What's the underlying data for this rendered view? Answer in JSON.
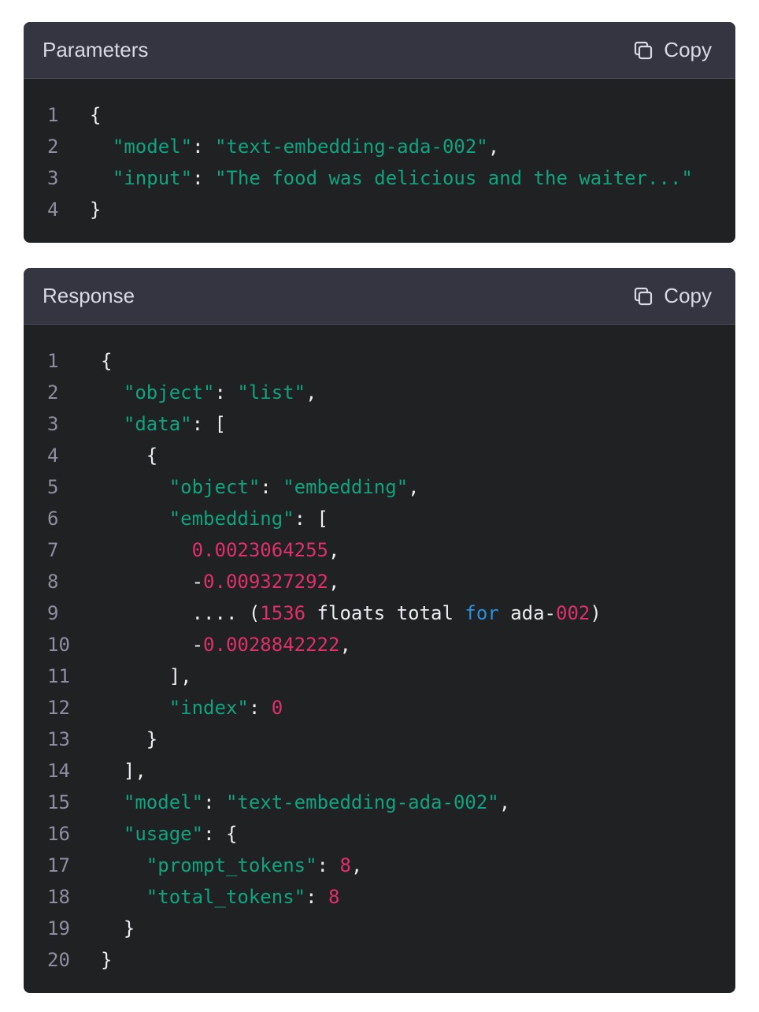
{
  "colors": {
    "panel_bg": "#202123",
    "header_bg": "#343541",
    "string": "#10a37f",
    "number": "#e0306a",
    "keyword": "#2b8fdb",
    "line_number": "#8e8ea0"
  },
  "parameters": {
    "title": "Parameters",
    "copy_label": "Copy",
    "copy_icon": "copy-icon",
    "lines": [
      {
        "n": "1",
        "tokens": [
          {
            "t": "{",
            "c": "punc"
          }
        ]
      },
      {
        "n": "2",
        "tokens": [
          {
            "t": "  ",
            "c": "plain"
          },
          {
            "t": "\"model\"",
            "c": "key"
          },
          {
            "t": ": ",
            "c": "punc"
          },
          {
            "t": "\"text-embedding-ada-002\"",
            "c": "str"
          },
          {
            "t": ",",
            "c": "punc"
          }
        ]
      },
      {
        "n": "3",
        "tokens": [
          {
            "t": "  ",
            "c": "plain"
          },
          {
            "t": "\"input\"",
            "c": "key"
          },
          {
            "t": ": ",
            "c": "punc"
          },
          {
            "t": "\"The food was delicious and the waiter...\"",
            "c": "str"
          }
        ]
      },
      {
        "n": "4",
        "tokens": [
          {
            "t": "}",
            "c": "punc"
          }
        ]
      }
    ]
  },
  "response": {
    "title": "Response",
    "copy_label": "Copy",
    "copy_icon": "copy-icon",
    "lines": [
      {
        "n": "1",
        "tokens": [
          {
            "t": "{",
            "c": "punc"
          }
        ]
      },
      {
        "n": "2",
        "tokens": [
          {
            "t": "  ",
            "c": "plain"
          },
          {
            "t": "\"object\"",
            "c": "key"
          },
          {
            "t": ": ",
            "c": "punc"
          },
          {
            "t": "\"list\"",
            "c": "str"
          },
          {
            "t": ",",
            "c": "punc"
          }
        ]
      },
      {
        "n": "3",
        "tokens": [
          {
            "t": "  ",
            "c": "plain"
          },
          {
            "t": "\"data\"",
            "c": "key"
          },
          {
            "t": ": [",
            "c": "punc"
          }
        ]
      },
      {
        "n": "4",
        "tokens": [
          {
            "t": "    {",
            "c": "punc"
          }
        ]
      },
      {
        "n": "5",
        "tokens": [
          {
            "t": "      ",
            "c": "plain"
          },
          {
            "t": "\"object\"",
            "c": "key"
          },
          {
            "t": ": ",
            "c": "punc"
          },
          {
            "t": "\"embedding\"",
            "c": "str"
          },
          {
            "t": ",",
            "c": "punc"
          }
        ]
      },
      {
        "n": "6",
        "tokens": [
          {
            "t": "      ",
            "c": "plain"
          },
          {
            "t": "\"embedding\"",
            "c": "key"
          },
          {
            "t": ": [",
            "c": "punc"
          }
        ]
      },
      {
        "n": "7",
        "tokens": [
          {
            "t": "        ",
            "c": "plain"
          },
          {
            "t": "0.0023064255",
            "c": "num"
          },
          {
            "t": ",",
            "c": "punc"
          }
        ]
      },
      {
        "n": "8",
        "tokens": [
          {
            "t": "        -",
            "c": "plain"
          },
          {
            "t": "0.009327292",
            "c": "num"
          },
          {
            "t": ",",
            "c": "punc"
          }
        ]
      },
      {
        "n": "9",
        "tokens": [
          {
            "t": "        .... (",
            "c": "plain"
          },
          {
            "t": "1536",
            "c": "num"
          },
          {
            "t": " floats total ",
            "c": "plain"
          },
          {
            "t": "for",
            "c": "kw"
          },
          {
            "t": " ada-",
            "c": "plain"
          },
          {
            "t": "002",
            "c": "num"
          },
          {
            "t": ")",
            "c": "plain"
          }
        ]
      },
      {
        "n": "10",
        "tokens": [
          {
            "t": "        -",
            "c": "plain"
          },
          {
            "t": "0.0028842222",
            "c": "num"
          },
          {
            "t": ",",
            "c": "punc"
          }
        ]
      },
      {
        "n": "11",
        "tokens": [
          {
            "t": "      ],",
            "c": "punc"
          }
        ]
      },
      {
        "n": "12",
        "tokens": [
          {
            "t": "      ",
            "c": "plain"
          },
          {
            "t": "\"index\"",
            "c": "key"
          },
          {
            "t": ": ",
            "c": "punc"
          },
          {
            "t": "0",
            "c": "num"
          }
        ]
      },
      {
        "n": "13",
        "tokens": [
          {
            "t": "    }",
            "c": "punc"
          }
        ]
      },
      {
        "n": "14",
        "tokens": [
          {
            "t": "  ],",
            "c": "punc"
          }
        ]
      },
      {
        "n": "15",
        "tokens": [
          {
            "t": "  ",
            "c": "plain"
          },
          {
            "t": "\"model\"",
            "c": "key"
          },
          {
            "t": ": ",
            "c": "punc"
          },
          {
            "t": "\"text-embedding-ada-002\"",
            "c": "str"
          },
          {
            "t": ",",
            "c": "punc"
          }
        ]
      },
      {
        "n": "16",
        "tokens": [
          {
            "t": "  ",
            "c": "plain"
          },
          {
            "t": "\"usage\"",
            "c": "key"
          },
          {
            "t": ": {",
            "c": "punc"
          }
        ]
      },
      {
        "n": "17",
        "tokens": [
          {
            "t": "    ",
            "c": "plain"
          },
          {
            "t": "\"prompt_tokens\"",
            "c": "key"
          },
          {
            "t": ": ",
            "c": "punc"
          },
          {
            "t": "8",
            "c": "num"
          },
          {
            "t": ",",
            "c": "punc"
          }
        ]
      },
      {
        "n": "18",
        "tokens": [
          {
            "t": "    ",
            "c": "plain"
          },
          {
            "t": "\"total_tokens\"",
            "c": "key"
          },
          {
            "t": ": ",
            "c": "punc"
          },
          {
            "t": "8",
            "c": "num"
          }
        ]
      },
      {
        "n": "19",
        "tokens": [
          {
            "t": "  }",
            "c": "punc"
          }
        ]
      },
      {
        "n": "20",
        "tokens": [
          {
            "t": "}",
            "c": "punc"
          }
        ]
      }
    ]
  }
}
